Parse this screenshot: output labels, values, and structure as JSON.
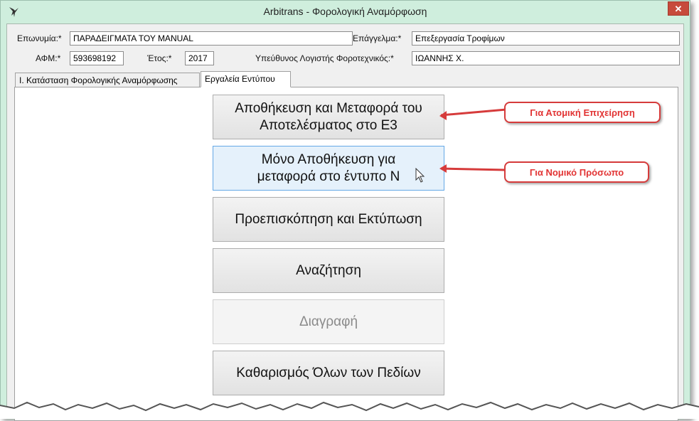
{
  "window": {
    "title": "Arbitrans - Φορολογική Αναμόρφωση",
    "close_glyph": "✕"
  },
  "header": {
    "eponymia_label": "Επωνυμία:*",
    "eponymia_value": "ΠΑΡΑΔΕΙΓΜΑΤΑ ΤΟΥ MANUAL",
    "epaggelma_label": "Επάγγελμα:*",
    "epaggelma_value": "Επεξεργασία Τροφίμων",
    "afm_label": "ΑΦΜ:*",
    "afm_value": "593698192",
    "etos_label": "Έτος:*",
    "etos_value": "2017",
    "logistis_label": "Υπεύθυνος Λογιστής Φοροτεχνικός:*",
    "logistis_value": "ΙΩΑΝΝΗΣ Χ."
  },
  "tabs": [
    {
      "label": "Ι. Κατάσταση Φορολογικής Αναμόρφωσης",
      "active": false
    },
    {
      "label": "Εργαλεία Εντύπου",
      "active": true
    }
  ],
  "buttons": {
    "save_transfer_e3": "Αποθήκευση και Μεταφορά του\nΑποτελέσματος στο Ε3",
    "save_only_n": "Μόνο Αποθήκευση για\nμεταφορά στο έντυπο Ν",
    "preview_print": "Προεπισκόπηση και Εκτύπωση",
    "search": "Αναζήτηση",
    "delete": "Διαγραφή",
    "clear_all": "Καθαρισμός Όλων των Πεδίων"
  },
  "callouts": {
    "individual": "Για Ατομική Επιχείρηση",
    "legal_entity": "Για Νομικό Πρόσωπο"
  },
  "colors": {
    "titlebar": "#cfeedd",
    "close": "#c74a3b",
    "callout": "#e23434",
    "hover": "#e5f1fb"
  }
}
